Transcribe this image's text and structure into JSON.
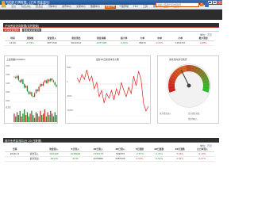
{
  "window": {
    "title": "同花顺 行情数据 - [沪深 资金流向]",
    "min": "_",
    "max": "□",
    "close": "×"
  },
  "menubar": {
    "items": [
      {
        "label": "系统"
      },
      {
        "label": "首页"
      },
      {
        "label": "综合排名"
      },
      {
        "label": "自选股"
      },
      {
        "label": "行情中心"
      },
      {
        "label": "资讯中心"
      },
      {
        "label": "交易中心"
      },
      {
        "label": "数据中心"
      },
      {
        "label": "资金流向"
      },
      {
        "label": "个股异动"
      },
      {
        "label": "F10"
      },
      {
        "label": "工具"
      },
      {
        "label": "帮助"
      },
      {
        "label": "设置"
      },
      {
        "label": "委托"
      }
    ],
    "active_index": 8
  },
  "topbar": {
    "crumb1": "数据中心",
    "crumb2": "沪深市场",
    "crumb3": "上证资金",
    "sep": "›",
    "search_placeholder": "请输入股票代码或简称"
  },
  "section1": {
    "title": "沪深资金流向数据(实时更新)",
    "tabs": [
      "沪深资金流向",
      "各板块资金流向"
    ],
    "unit": "单位：万元",
    "table": {
      "headers": [
        "时间",
        "涨跌幅",
        "资金流入",
        "资金流出",
        "资金净额",
        "超大单",
        "大单",
        "中单",
        "小单",
        "散户资金"
      ],
      "row": [
        "15:00",
        "-0.79%",
        "3977249",
        "5034744",
        "-1057495",
        "-0.91%",
        "35070",
        "0.55%",
        "1202727",
        "0.48%"
      ]
    }
  },
  "charts": {
    "kline": {
      "title": "上证指数(000001)",
      "price_labels": [
        "3300",
        "3200",
        "3100",
        "3000",
        "2900"
      ],
      "volume_label": "成交量"
    },
    "flow": {
      "title": "最新30日资金净流入图",
      "y_labels": [
        "5000",
        "0",
        "-5000",
        "-10000"
      ]
    },
    "gauge": {
      "title": "资金流向多空情况",
      "legend": [
        "多方资金流入",
        "空方资金流出",
        "资金净流入"
      ],
      "level": 0.38
    }
  },
  "chart_data": [
    {
      "type": "line",
      "title": "上证指数(000001)",
      "series": [
        {
          "values": [
            3180,
            3165,
            3190,
            3140,
            3120,
            3150,
            3100,
            3060,
            3080,
            3020,
            2990,
            3010,
            2970,
            2960,
            3000,
            3040,
            3020,
            3070,
            3100,
            3080,
            3120,
            3140,
            3110,
            3150,
            3130,
            3160,
            3140,
            3120,
            3090,
            3070
          ]
        }
      ]
    },
    {
      "type": "bar",
      "title": "成交量",
      "values": [
        6,
        4,
        7,
        5,
        8,
        4,
        6,
        9,
        5,
        7,
        4,
        6,
        8,
        5,
        3,
        7,
        6,
        4,
        8,
        5,
        6,
        9,
        4,
        7,
        5,
        8,
        6,
        4,
        7,
        5
      ]
    },
    {
      "type": "line",
      "title": "最新30日资金净流入图",
      "x": [
        1,
        2,
        3,
        4,
        5,
        6,
        7,
        8,
        9,
        10,
        11,
        12,
        13,
        14,
        15,
        16,
        17,
        18,
        19,
        20,
        21,
        22,
        23,
        24,
        25,
        26,
        27,
        28,
        29,
        30
      ],
      "values": [
        2000,
        500,
        3000,
        1500,
        4500,
        1000,
        2500,
        -1500,
        500,
        -4000,
        -2000,
        -6000,
        -3000,
        -4500,
        -2000,
        -5000,
        -1500,
        -3500,
        500,
        -2000,
        -4000,
        -1000,
        -3000,
        2500,
        -500,
        4000,
        1500,
        -6000,
        -8500,
        -7000
      ],
      "ylim": [
        -10000,
        6000
      ]
    },
    {
      "type": "pie",
      "title": "资金流向多空情况",
      "categories": [
        "空方资金流出",
        "多方资金流入"
      ],
      "values": [
        0.62,
        0.38
      ]
    }
  ],
  "section2": {
    "title": "各行业资金流向(近 20 日数据)",
    "unit": "单位：万元",
    "table": {
      "headers": [
        "日期",
        "",
        "资金流入",
        "5日流入",
        "10日流入",
        "20日流入",
        "5日涨跌",
        "10日涨跌",
        "20日涨跌",
        "主力净流入"
      ],
      "rows": [
        [
          "2016-11",
          "资金流入",
          "-567469",
          "-4138662",
          "-7193170",
          "502053",
          "-2.57%",
          "-2.71%",
          "3.22%",
          "0.19%"
        ],
        [
          "",
          "资金流出",
          "-20139",
          "-6735",
          "1535686",
          "3287500",
          "0.50%",
          "-0.52%",
          "2.54%",
          "0.27%"
        ]
      ]
    }
  }
}
